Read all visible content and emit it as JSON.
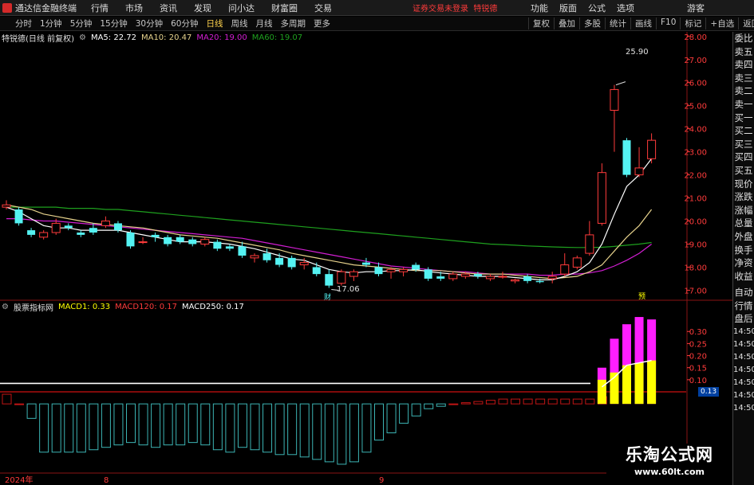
{
  "menubar": {
    "app_title": "通达信金融终端",
    "menus": [
      "行情",
      "市场",
      "资讯",
      "发现",
      "问小达",
      "财富圈",
      "交易"
    ],
    "status": "证券交易未登录",
    "status_user": "特锐德",
    "right_menus": [
      "功能",
      "版面",
      "公式",
      "选项"
    ],
    "guest": "游客"
  },
  "period_tabs": {
    "tabs": [
      "分时",
      "1分钟",
      "5分钟",
      "15分钟",
      "30分钟",
      "60分钟",
      "日线",
      "周线",
      "月线",
      "多周期",
      "更多"
    ],
    "active": "日线",
    "right_tabs": [
      "复权",
      "叠加",
      "多股",
      "统计",
      "画线",
      "F10",
      "标记",
      "+自选",
      "返回"
    ]
  },
  "main_legend": {
    "stock": "特锐德(日线 前复权)",
    "ma5": "MA5: 22.72",
    "ma10": "MA10: 20.47",
    "ma20": "MA20: 19.00",
    "ma60": "MA60: 19.07"
  },
  "macd_legend": {
    "name": "股票指标网",
    "macd1": "MACD1: 0.33",
    "macd120": "MACD120: 0.17",
    "macd250": "MACD250: 0.17"
  },
  "side_panel": {
    "labels": [
      "委比",
      "卖五",
      "卖四",
      "卖三",
      "卖二",
      "卖一",
      "买一",
      "买二",
      "买三",
      "买四",
      "买五",
      "现价",
      "涨跌",
      "涨幅",
      "总量",
      "外盘",
      "换手",
      "净资",
      "收益",
      "自动",
      "行情",
      "盘后"
    ],
    "times": [
      "14:50",
      "14:50",
      "14:50",
      "14:50",
      "14:50",
      "14:50",
      "14:50"
    ]
  },
  "annotations": {
    "high_label": "25.90",
    "low_label": "17.06",
    "low_marker": "财",
    "macd_badge": "0.13",
    "mark_yu": "预"
  },
  "date_axis": [
    "2024年",
    "8",
    "9"
  ],
  "colors": {
    "up": "#ff3b3b",
    "down": "#54f2f2",
    "ma5": "#ffffff",
    "ma10": "#e6d28c",
    "ma20": "#d21ed2",
    "ma60": "#1ea01e",
    "macd_pink": "#ff1eff",
    "macd_yellow": "#ffff00"
  },
  "watermark": {
    "line1": "乐淘公式网",
    "line2": "www.60lt.com"
  },
  "chart_data": [
    {
      "type": "candlestick",
      "title": "特锐德(日线 前复权)",
      "ylim": [
        16.6,
        28.2
      ],
      "yticks": [
        17.0,
        18.0,
        19.0,
        20.0,
        21.0,
        22.0,
        23.0,
        24.0,
        25.0,
        26.0,
        27.0,
        28.0
      ],
      "ohlc": [
        [
          20.6,
          20.9,
          20.5,
          20.7
        ],
        [
          20.5,
          20.6,
          19.8,
          19.9
        ],
        [
          19.6,
          19.7,
          19.3,
          19.4
        ],
        [
          19.3,
          19.6,
          19.2,
          19.5
        ],
        [
          19.5,
          20.1,
          19.4,
          19.9
        ],
        [
          19.8,
          19.9,
          19.6,
          19.7
        ],
        [
          19.5,
          19.6,
          19.3,
          19.4
        ],
        [
          19.7,
          19.9,
          19.4,
          19.5
        ],
        [
          19.8,
          20.2,
          19.7,
          20.0
        ],
        [
          19.9,
          20.0,
          19.5,
          19.6
        ],
        [
          19.5,
          19.6,
          18.8,
          18.9
        ],
        [
          19.1,
          19.3,
          19.0,
          19.1
        ],
        [
          19.4,
          19.5,
          19.1,
          19.3
        ],
        [
          19.3,
          19.4,
          18.9,
          19.0
        ],
        [
          19.3,
          19.4,
          19.0,
          19.1
        ],
        [
          19.2,
          19.3,
          18.9,
          19.0
        ],
        [
          19.0,
          19.3,
          18.9,
          19.2
        ],
        [
          19.1,
          19.2,
          18.7,
          18.8
        ],
        [
          18.9,
          19.0,
          18.7,
          18.8
        ],
        [
          18.9,
          19.1,
          18.4,
          18.5
        ],
        [
          18.4,
          18.6,
          18.2,
          18.5
        ],
        [
          18.6,
          18.8,
          18.2,
          18.3
        ],
        [
          18.4,
          18.6,
          18.0,
          18.1
        ],
        [
          18.4,
          18.5,
          17.9,
          18.0
        ],
        [
          18.1,
          18.4,
          17.9,
          18.2
        ],
        [
          18.0,
          18.2,
          17.6,
          17.7
        ],
        [
          17.7,
          17.9,
          17.1,
          17.2
        ],
        [
          17.3,
          17.9,
          17.2,
          17.8
        ],
        [
          17.6,
          17.9,
          17.4,
          17.8
        ],
        [
          18.2,
          18.4,
          18.0,
          18.1
        ],
        [
          18.0,
          18.2,
          17.6,
          17.7
        ],
        [
          17.8,
          18.0,
          17.5,
          17.9
        ],
        [
          17.8,
          18.0,
          17.6,
          17.9
        ],
        [
          18.1,
          18.2,
          17.8,
          17.9
        ],
        [
          17.9,
          18.0,
          17.4,
          17.5
        ],
        [
          17.6,
          17.8,
          17.4,
          17.5
        ],
        [
          17.5,
          17.8,
          17.4,
          17.7
        ],
        [
          17.6,
          17.8,
          17.5,
          17.7
        ],
        [
          17.7,
          17.8,
          17.5,
          17.6
        ],
        [
          17.5,
          17.7,
          17.4,
          17.6
        ],
        [
          17.6,
          17.8,
          17.5,
          17.6
        ],
        [
          17.4,
          17.5,
          17.3,
          17.45
        ],
        [
          17.6,
          17.7,
          17.3,
          17.4
        ],
        [
          17.4,
          17.5,
          17.3,
          17.35
        ],
        [
          17.5,
          17.8,
          17.3,
          17.6
        ],
        [
          17.7,
          18.6,
          17.6,
          18.1
        ],
        [
          18.0,
          18.5,
          17.9,
          18.4
        ],
        [
          18.6,
          20.0,
          18.5,
          19.4
        ],
        [
          19.9,
          22.5,
          19.8,
          22.1
        ],
        [
          24.8,
          25.9,
          23.0,
          25.7
        ],
        [
          23.5,
          23.6,
          21.9,
          22.0
        ],
        [
          22.0,
          23.2,
          21.9,
          22.3
        ],
        [
          22.7,
          23.8,
          22.5,
          23.5
        ]
      ],
      "ma5": [
        20.6,
        20.4,
        20.1,
        19.8,
        19.7,
        19.7,
        19.6,
        19.6,
        19.6,
        19.6,
        19.5,
        19.4,
        19.3,
        19.2,
        19.1,
        19.1,
        19.1,
        19.05,
        19.0,
        18.9,
        18.8,
        18.65,
        18.5,
        18.35,
        18.3,
        18.1,
        17.9,
        17.8,
        17.75,
        17.8,
        17.8,
        17.85,
        17.85,
        17.9,
        17.8,
        17.75,
        17.7,
        17.65,
        17.6,
        17.6,
        17.6,
        17.55,
        17.5,
        17.45,
        17.45,
        17.6,
        17.8,
        18.2,
        19.0,
        20.3,
        21.5,
        22.0,
        22.7
      ],
      "ma10": [
        20.7,
        20.6,
        20.5,
        20.3,
        20.2,
        20.1,
        20.0,
        19.9,
        19.85,
        19.8,
        19.75,
        19.7,
        19.6,
        19.5,
        19.4,
        19.35,
        19.3,
        19.25,
        19.15,
        19.05,
        18.95,
        18.85,
        18.75,
        18.6,
        18.5,
        18.4,
        18.3,
        18.2,
        18.1,
        18.05,
        18.0,
        17.95,
        17.9,
        17.85,
        17.85,
        17.85,
        17.8,
        17.75,
        17.7,
        17.7,
        17.7,
        17.65,
        17.6,
        17.55,
        17.5,
        17.55,
        17.6,
        17.8,
        18.1,
        18.7,
        19.3,
        19.8,
        20.5
      ],
      "ma20": [
        20.1,
        20.1,
        20.05,
        20.0,
        20.0,
        19.95,
        19.9,
        19.85,
        19.8,
        19.75,
        19.7,
        19.65,
        19.6,
        19.55,
        19.5,
        19.45,
        19.4,
        19.35,
        19.3,
        19.25,
        19.15,
        19.05,
        18.95,
        18.85,
        18.75,
        18.65,
        18.55,
        18.45,
        18.35,
        18.25,
        18.15,
        18.05,
        18.0,
        17.95,
        17.9,
        17.85,
        17.8,
        17.8,
        17.75,
        17.7,
        17.7,
        17.7,
        17.7,
        17.65,
        17.65,
        17.7,
        17.7,
        17.75,
        17.85,
        18.05,
        18.3,
        18.6,
        19.0
      ],
      "ma60": [
        20.6,
        20.6,
        20.6,
        20.6,
        20.6,
        20.55,
        20.55,
        20.55,
        20.5,
        20.5,
        20.45,
        20.4,
        20.35,
        20.3,
        20.25,
        20.2,
        20.15,
        20.1,
        20.05,
        20.0,
        19.95,
        19.9,
        19.85,
        19.8,
        19.75,
        19.7,
        19.65,
        19.6,
        19.55,
        19.5,
        19.45,
        19.4,
        19.35,
        19.3,
        19.25,
        19.2,
        19.15,
        19.1,
        19.05,
        19.0,
        18.98,
        18.95,
        18.92,
        18.9,
        18.88,
        18.86,
        18.85,
        18.85,
        18.86,
        18.9,
        18.95,
        19.0,
        19.07
      ]
    },
    {
      "type": "bar",
      "title": "股票指标网",
      "ylim": [
        -0.28,
        0.38
      ],
      "yticks": [
        0.1,
        0.15,
        0.2,
        0.25,
        0.3
      ],
      "baseline_value": 0.0,
      "white_line_value": 0.085,
      "red_line_value": 0.05,
      "histogram": [
        0.04,
        0.0,
        -0.06,
        -0.2,
        -0.2,
        -0.2,
        -0.2,
        -0.19,
        -0.18,
        -0.17,
        -0.16,
        -0.17,
        -0.18,
        -0.17,
        -0.17,
        -0.16,
        -0.17,
        -0.19,
        -0.2,
        -0.18,
        -0.19,
        -0.2,
        -0.21,
        -0.21,
        -0.22,
        -0.23,
        -0.24,
        -0.25,
        -0.24,
        -0.2,
        -0.15,
        -0.12,
        -0.08,
        -0.05,
        -0.02,
        -0.01,
        0.0,
        0.005,
        0.01,
        0.015,
        0.02,
        0.02,
        0.02,
        0.02,
        0.02,
        0.02,
        0.02,
        0.02,
        0.03
      ],
      "pink_bars": [
        0.15,
        0.27,
        0.33,
        0.36,
        0.35
      ],
      "yellow_bars": [
        0.1,
        0.13,
        0.16,
        0.17,
        0.18
      ],
      "white_curve": [
        0.07,
        0.11,
        0.16,
        0.17,
        0.18
      ]
    }
  ]
}
